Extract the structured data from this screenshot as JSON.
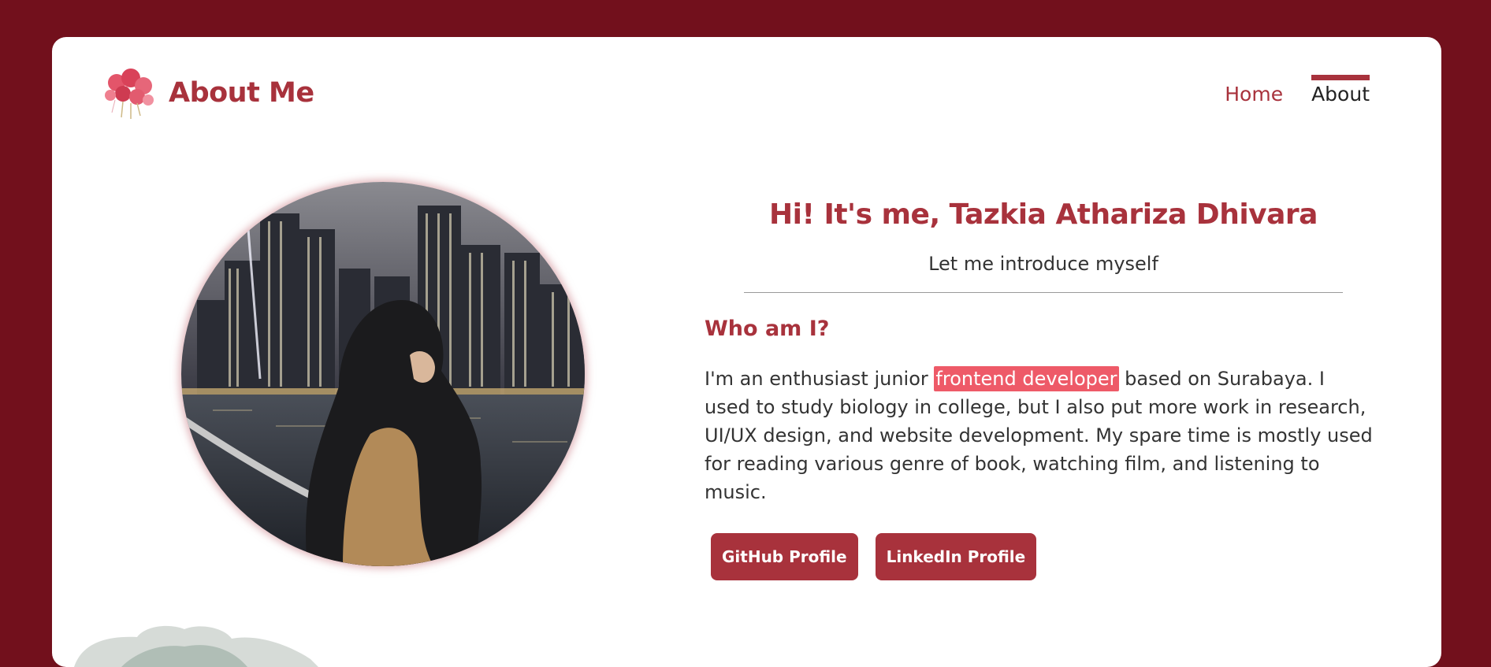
{
  "header": {
    "title": "About Me",
    "logo_icon": "flower-bouquet-icon",
    "nav": [
      {
        "label": "Home",
        "active": false
      },
      {
        "label": "About",
        "active": true
      }
    ]
  },
  "main": {
    "greeting": "Hi! It's me, Tazkia Athariza Dhivara",
    "subtitle": "Let me introduce myself",
    "section_title": "Who am I?",
    "bio": {
      "before": "I'm an enthusiast junior ",
      "highlight": "frontend developer",
      "after": " based on Surabaya. I used to study biology in college, but I also put more work in research, UI/UX design, and website development. My spare time is mostly used for reading various genre of book, watching film, and listening to music."
    },
    "buttons": {
      "github": "GitHub Profile",
      "linkedin": "LinkedIn Profile"
    }
  },
  "colors": {
    "background": "#72101c",
    "accent": "#a8323c",
    "highlight": "#ee5a68"
  }
}
